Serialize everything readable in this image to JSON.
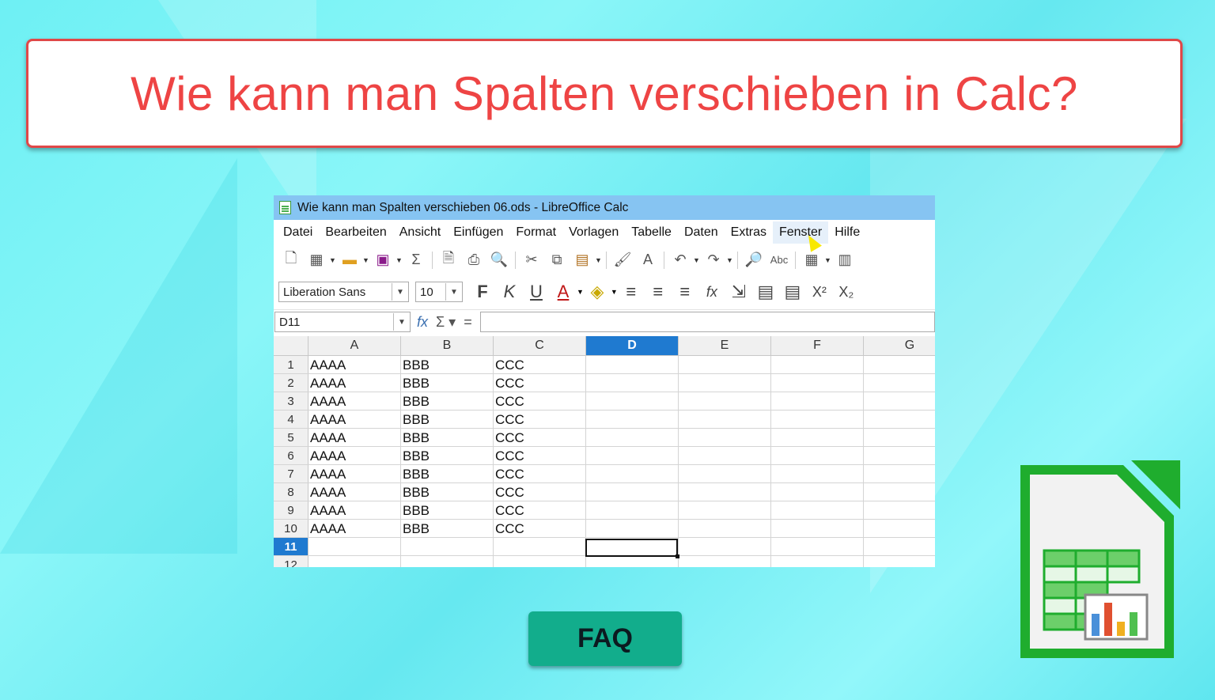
{
  "title": "Wie kann man Spalten verschieben in Calc?",
  "window": {
    "title": "Wie kann man Spalten verschieben 06.ods - LibreOffice Calc",
    "menu": [
      "Datei",
      "Bearbeiten",
      "Ansicht",
      "Einfügen",
      "Format",
      "Vorlagen",
      "Tabelle",
      "Daten",
      "Extras",
      "Fenster",
      "Hilfe"
    ],
    "font_name": "Liberation Sans",
    "font_size": "10",
    "format_buttons": {
      "bold": "F",
      "italic": "K",
      "underline": "U"
    },
    "name_box": "D11",
    "columns": [
      "A",
      "B",
      "C",
      "D",
      "E",
      "F",
      "G"
    ],
    "selected_column": "D",
    "rows": [
      {
        "n": "1",
        "a": "AAAA",
        "b": "BBB",
        "c": "CCC"
      },
      {
        "n": "2",
        "a": "AAAA",
        "b": "BBB",
        "c": "CCC"
      },
      {
        "n": "3",
        "a": "AAAA",
        "b": "BBB",
        "c": "CCC"
      },
      {
        "n": "4",
        "a": "AAAA",
        "b": "BBB",
        "c": "CCC"
      },
      {
        "n": "5",
        "a": "AAAA",
        "b": "BBB",
        "c": "CCC"
      },
      {
        "n": "6",
        "a": "AAAA",
        "b": "BBB",
        "c": "CCC"
      },
      {
        "n": "7",
        "a": "AAAA",
        "b": "BBB",
        "c": "CCC"
      },
      {
        "n": "8",
        "a": "AAAA",
        "b": "BBB",
        "c": "CCC"
      },
      {
        "n": "9",
        "a": "AAAA",
        "b": "BBB",
        "c": "CCC"
      },
      {
        "n": "10",
        "a": "AAAA",
        "b": "BBB",
        "c": "CCC"
      },
      {
        "n": "11",
        "a": "",
        "b": "",
        "c": ""
      },
      {
        "n": "12",
        "a": "",
        "b": "",
        "c": ""
      }
    ],
    "selected_row": "11"
  },
  "faq_label": "FAQ",
  "colors": {
    "title_red": "#ee4444",
    "faq_green": "#12ad8c",
    "selection_blue": "#1f7ad0",
    "logo_green": "#1fad2e"
  }
}
